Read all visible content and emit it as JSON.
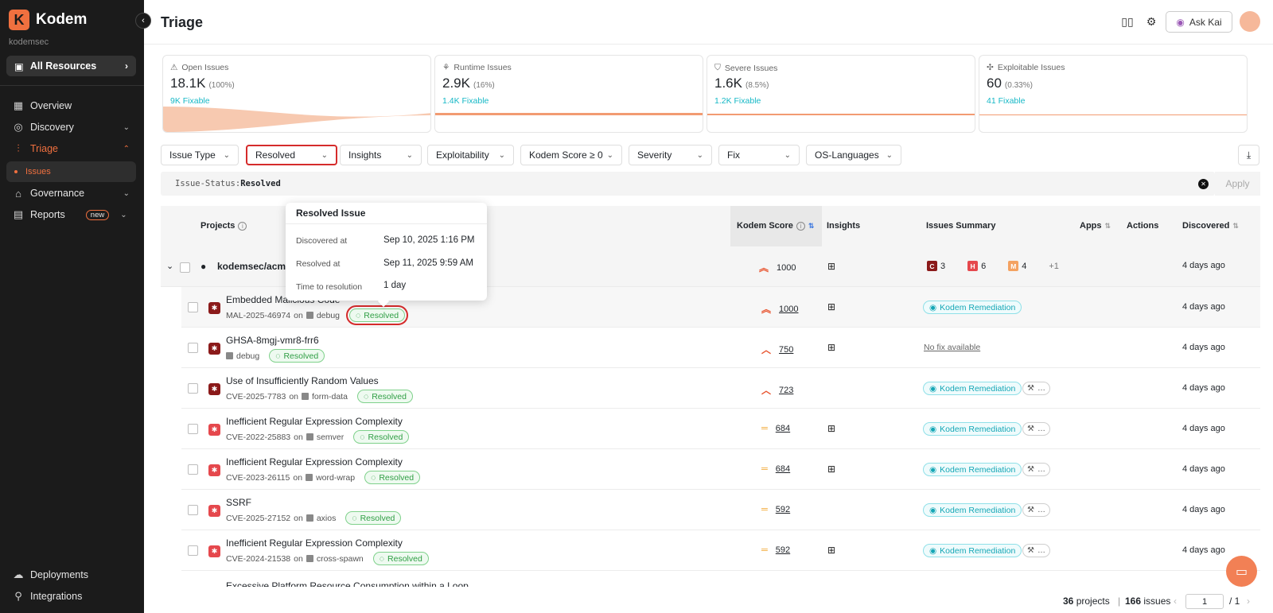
{
  "app": {
    "name": "Kodem",
    "org": "kodemsec"
  },
  "sidebar": {
    "resources_label": "All Resources",
    "items": [
      {
        "label": "Overview",
        "icon": "grid-icon"
      },
      {
        "label": "Discovery",
        "icon": "compass-icon"
      },
      {
        "label": "Triage",
        "icon": "triage-icon"
      },
      {
        "label": "Governance",
        "icon": "bank-icon"
      },
      {
        "label": "Reports",
        "icon": "report-icon",
        "badge": "new"
      }
    ],
    "sub_item": "Issues",
    "bottom": [
      {
        "label": "Deployments",
        "icon": "cloud-icon"
      },
      {
        "label": "Integrations",
        "icon": "plug-icon"
      }
    ]
  },
  "header": {
    "title": "Triage",
    "ask_label": "Ask Kai"
  },
  "cards": [
    {
      "label": "Open Issues",
      "value": "18.1K",
      "pct": "(100%)",
      "fixable": "9K Fixable"
    },
    {
      "label": "Runtime Issues",
      "value": "2.9K",
      "pct": "(16%)",
      "fixable": "1.4K Fixable"
    },
    {
      "label": "Severe Issues",
      "value": "1.6K",
      "pct": "(8.5%)",
      "fixable": "1.2K Fixable"
    },
    {
      "label": "Exploitable Issues",
      "value": "60",
      "pct": "(0.33%)",
      "fixable": "41 Fixable"
    }
  ],
  "filters": [
    "Issue Type",
    "Resolved",
    "Insights",
    "Exploitability",
    "Kodem Score ≥ 0",
    "Severity",
    "Fix",
    "OS-Languages"
  ],
  "query": {
    "key": "Issue-Status:",
    "value": "Resolved",
    "apply": "Apply"
  },
  "table": {
    "headers": {
      "projects": "Projects",
      "score": "Kodem Score",
      "insights": "Insights",
      "summary": "Issues Summary",
      "apps": "Apps",
      "actions": "Actions",
      "discovered": "Discovered"
    },
    "group": {
      "name": "kodemsec/acm",
      "score": "1000",
      "sev_c": "3",
      "sev_h": "6",
      "sev_m": "4",
      "more": "+1",
      "discovered": "4 days ago"
    },
    "rows": [
      {
        "title": "Embedded Malicious Code",
        "id": "MAL-2025-46974",
        "on": "on",
        "pkg": "debug",
        "status": "Resolved",
        "score": "1000",
        "score_icon": "double-up",
        "insight": true,
        "fix": "Kodem Remediation",
        "tool": false,
        "discovered": "4 days ago"
      },
      {
        "title": "GHSA-8mgj-vmr8-frr6",
        "id": "",
        "on": "",
        "pkg": "debug",
        "status": "Resolved",
        "score": "750",
        "score_icon": "up",
        "insight": true,
        "fix": "No fix available",
        "tool": false,
        "discovered": "4 days ago"
      },
      {
        "title": "Use of Insufficiently Random Values",
        "id": "CVE-2025-7783",
        "on": "on",
        "pkg": "form-data",
        "status": "Resolved",
        "score": "723",
        "score_icon": "up",
        "insight": false,
        "fix": "Kodem Remediation",
        "tool": true,
        "discovered": "4 days ago"
      },
      {
        "title": "Inefficient Regular Expression Complexity",
        "id": "CVE-2022-25883",
        "on": "on",
        "pkg": "semver",
        "status": "Resolved",
        "score": "684",
        "score_icon": "eq",
        "insight": true,
        "fix": "Kodem Remediation",
        "tool": true,
        "discovered": "4 days ago"
      },
      {
        "title": "Inefficient Regular Expression Complexity",
        "id": "CVE-2023-26115",
        "on": "on",
        "pkg": "word-wrap",
        "status": "Resolved",
        "score": "684",
        "score_icon": "eq",
        "insight": true,
        "fix": "Kodem Remediation",
        "tool": true,
        "discovered": "4 days ago"
      },
      {
        "title": "SSRF",
        "id": "CVE-2025-27152",
        "on": "on",
        "pkg": "axios",
        "status": "Resolved",
        "score": "592",
        "score_icon": "eq",
        "insight": false,
        "fix": "Kodem Remediation",
        "tool": true,
        "discovered": "4 days ago"
      },
      {
        "title": "Inefficient Regular Expression Complexity",
        "id": "CVE-2024-21538",
        "on": "on",
        "pkg": "cross-spawn",
        "status": "Resolved",
        "score": "592",
        "score_icon": "eq",
        "insight": true,
        "fix": "Kodem Remediation",
        "tool": true,
        "discovered": "4 days ago"
      }
    ],
    "cutoff_row": "Excessive Platform Resource Consumption within a Loop"
  },
  "tooltip": {
    "title": "Resolved Issue",
    "discovered_label": "Discovered at",
    "discovered_value": "Sep 10, 2025 1:16 PM",
    "resolved_label": "Resolved at",
    "resolved_value": "Sep 11, 2025 9:59 AM",
    "ttr_label": "Time to resolution",
    "ttr_value": "1 day"
  },
  "footer": {
    "projects_count": "36",
    "projects_label": "projects",
    "issues_count": "166",
    "issues_label": "issues",
    "page": "1",
    "pages": "/ 1"
  },
  "colors": {
    "accent": "#f0703f",
    "critical": "#8b1a1a",
    "high": "#e5484d",
    "medium": "#f4a261",
    "fixable": "#16b8c6",
    "resolved": "#2f9e44"
  }
}
